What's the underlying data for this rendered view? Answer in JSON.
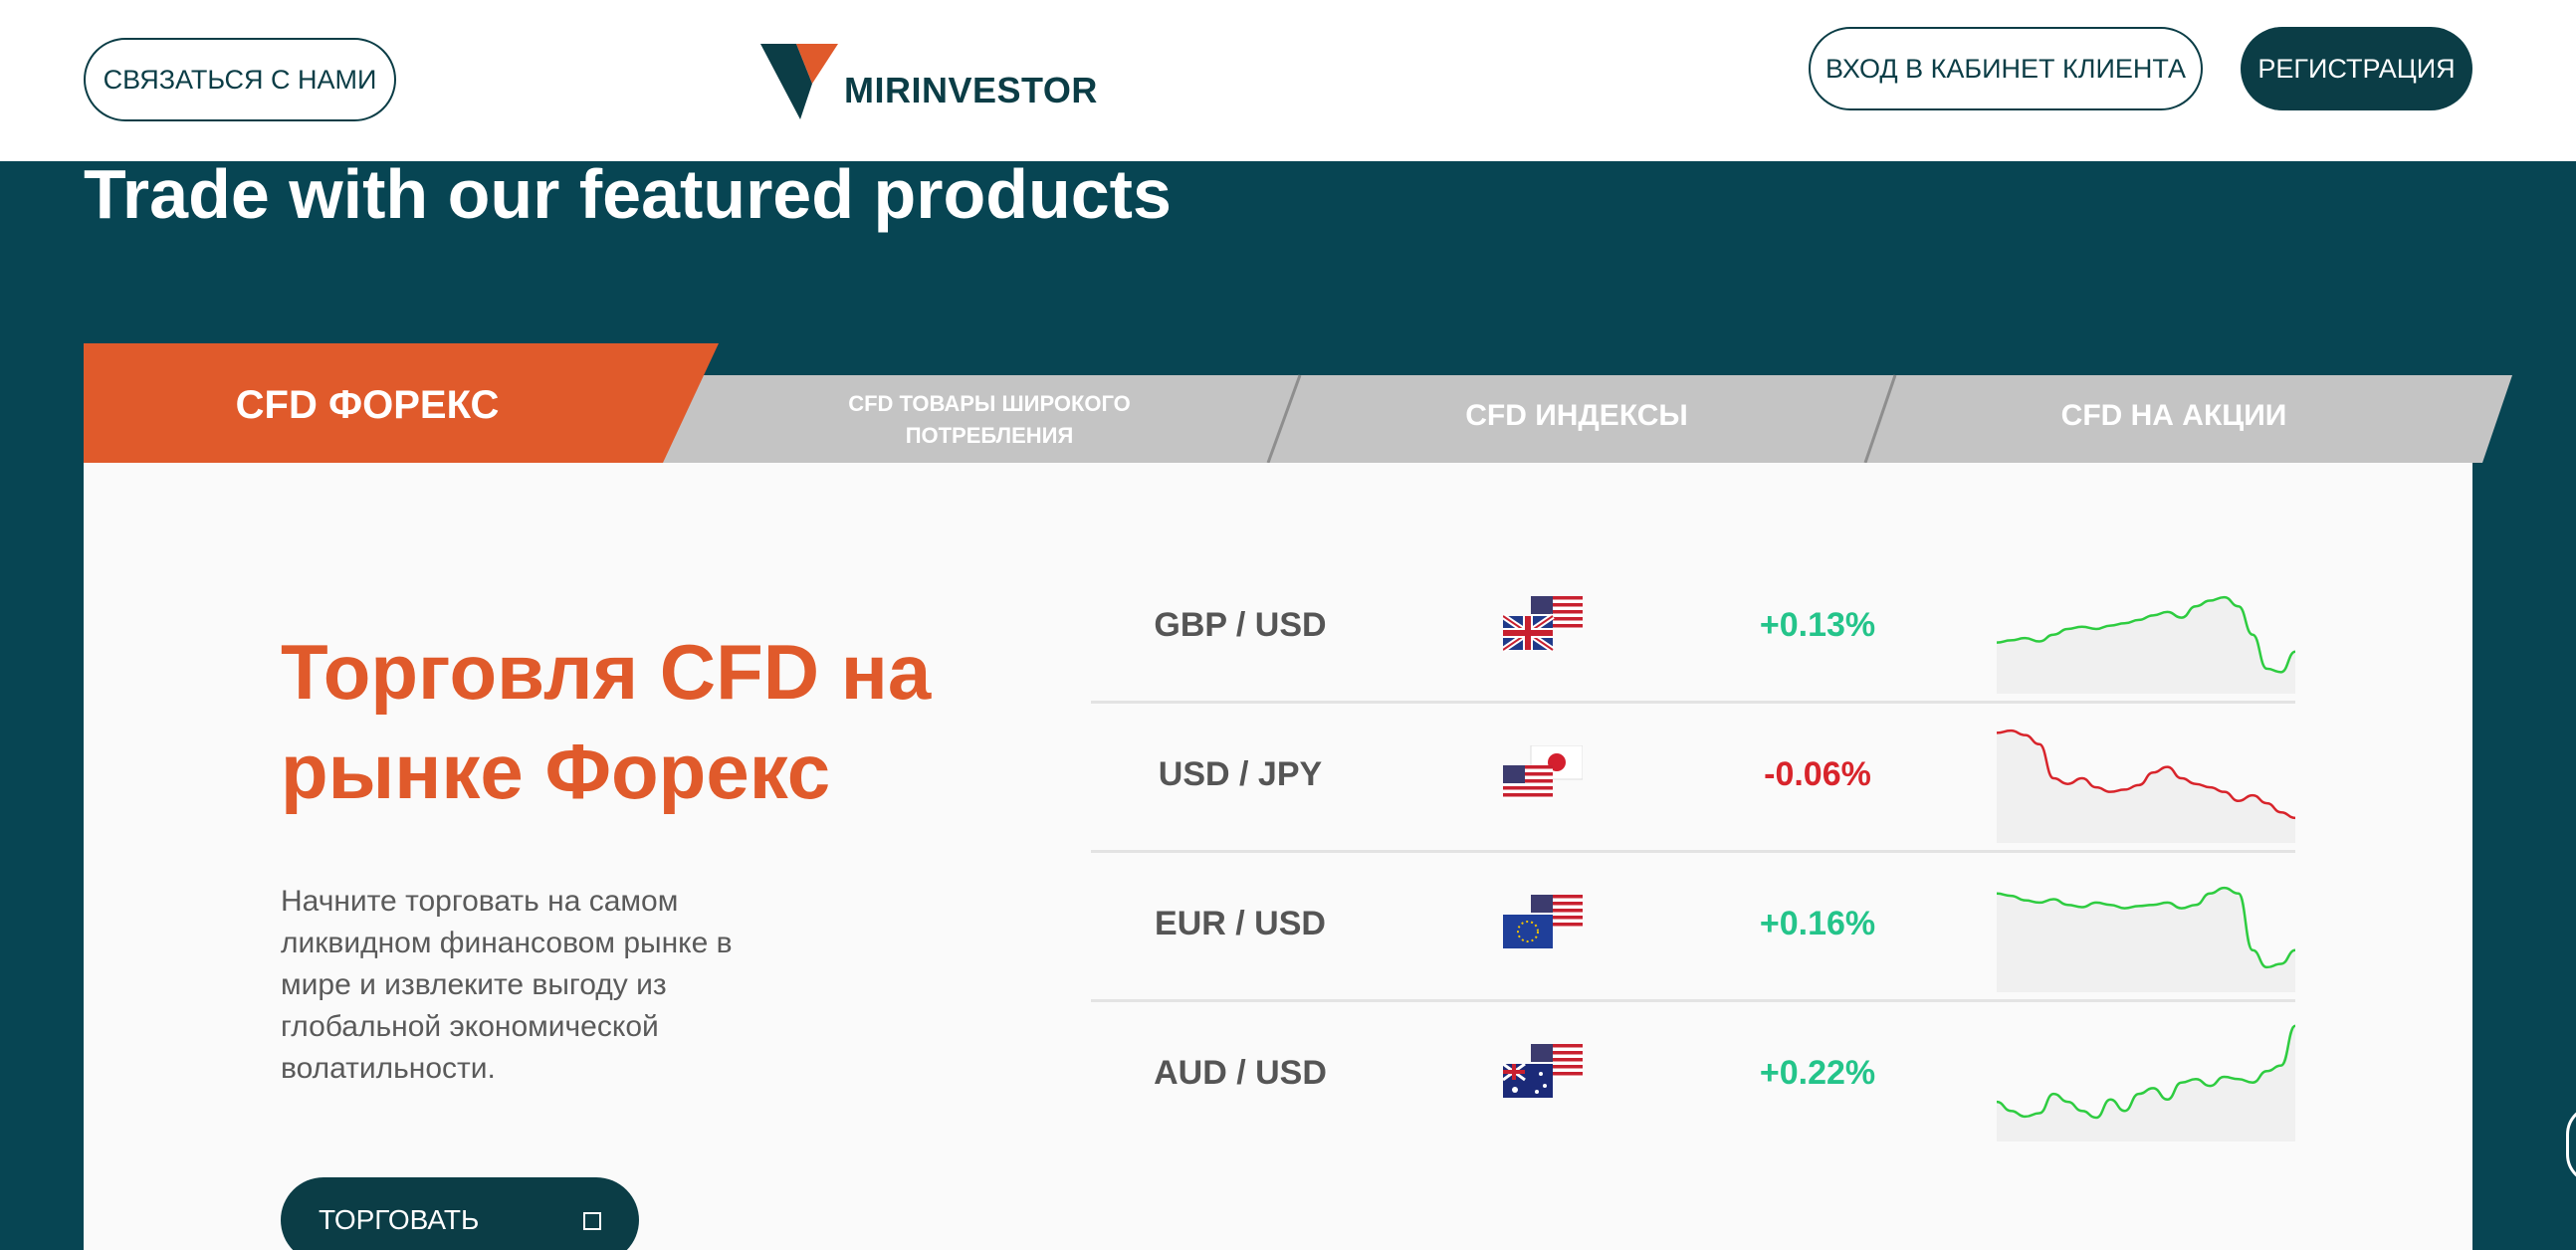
{
  "header": {
    "contact_label": "СВЯЗАТЬСЯ С НАМИ",
    "logo_text": "MIRINVESTOR",
    "login_label": "ВХОД В КАБИНЕТ КЛИЕНТА",
    "register_label": "РЕГИСТРАЦИЯ"
  },
  "page_heading": "Trade with our featured products",
  "tabs": [
    {
      "label": "CFD ФОРЕКС",
      "active": true
    },
    {
      "label": "CFD ТОВАРЫ ШИРОКОГО ПОТРЕБЛЕНИЯ",
      "active": false
    },
    {
      "label": "CFD ИНДЕКСЫ",
      "active": false
    },
    {
      "label": "CFD НА АКЦИИ",
      "active": false
    }
  ],
  "panel": {
    "title": "Торговля CFD на рынке Форекс",
    "description": "Начните торговать на самом ликвидном финансовом рынке в мире и извлеките выгоду из глобальной экономической волатильности.",
    "trade_label": "ТОРГОВАТЬ"
  },
  "quotes": [
    {
      "pair": "GBP / USD",
      "flags": [
        "gb-flag",
        "us-flag"
      ],
      "change": "+0.13%",
      "direction": "up",
      "spark": [
        0.62,
        0.6,
        0.58,
        0.61,
        0.55,
        0.5,
        0.48,
        0.5,
        0.47,
        0.45,
        0.42,
        0.38,
        0.35,
        0.4,
        0.3,
        0.25,
        0.22,
        0.3,
        0.55,
        0.85,
        0.88,
        0.7
      ]
    },
    {
      "pair": "USD / JPY",
      "flags": [
        "us-flag",
        "jp-flag"
      ],
      "change": "-0.06%",
      "direction": "down",
      "spark": [
        0.1,
        0.08,
        0.12,
        0.2,
        0.5,
        0.55,
        0.5,
        0.58,
        0.62,
        0.6,
        0.56,
        0.45,
        0.4,
        0.5,
        0.55,
        0.58,
        0.62,
        0.7,
        0.65,
        0.72,
        0.8,
        0.85
      ]
    },
    {
      "pair": "EUR / USD",
      "flags": [
        "eu-flag",
        "us-flag"
      ],
      "change": "+0.16%",
      "direction": "up",
      "spark": [
        0.2,
        0.22,
        0.26,
        0.28,
        0.25,
        0.3,
        0.32,
        0.28,
        0.3,
        0.33,
        0.31,
        0.3,
        0.28,
        0.33,
        0.3,
        0.2,
        0.15,
        0.2,
        0.7,
        0.85,
        0.82,
        0.7
      ]
    },
    {
      "pair": "AUD / USD",
      "flags": [
        "au-flag",
        "us-flag"
      ],
      "change": "+0.22%",
      "direction": "up",
      "spark": [
        0.72,
        0.8,
        0.85,
        0.82,
        0.65,
        0.72,
        0.8,
        0.86,
        0.7,
        0.8,
        0.65,
        0.6,
        0.7,
        0.55,
        0.52,
        0.58,
        0.5,
        0.52,
        0.55,
        0.45,
        0.4,
        0.05
      ]
    }
  ],
  "colors": {
    "brand_dark": "#0b3d46",
    "accent_orange": "#e05a2b",
    "tab_grey": "#c4c4c4",
    "up_green": "#24c48a",
    "down_red": "#d8242b"
  }
}
